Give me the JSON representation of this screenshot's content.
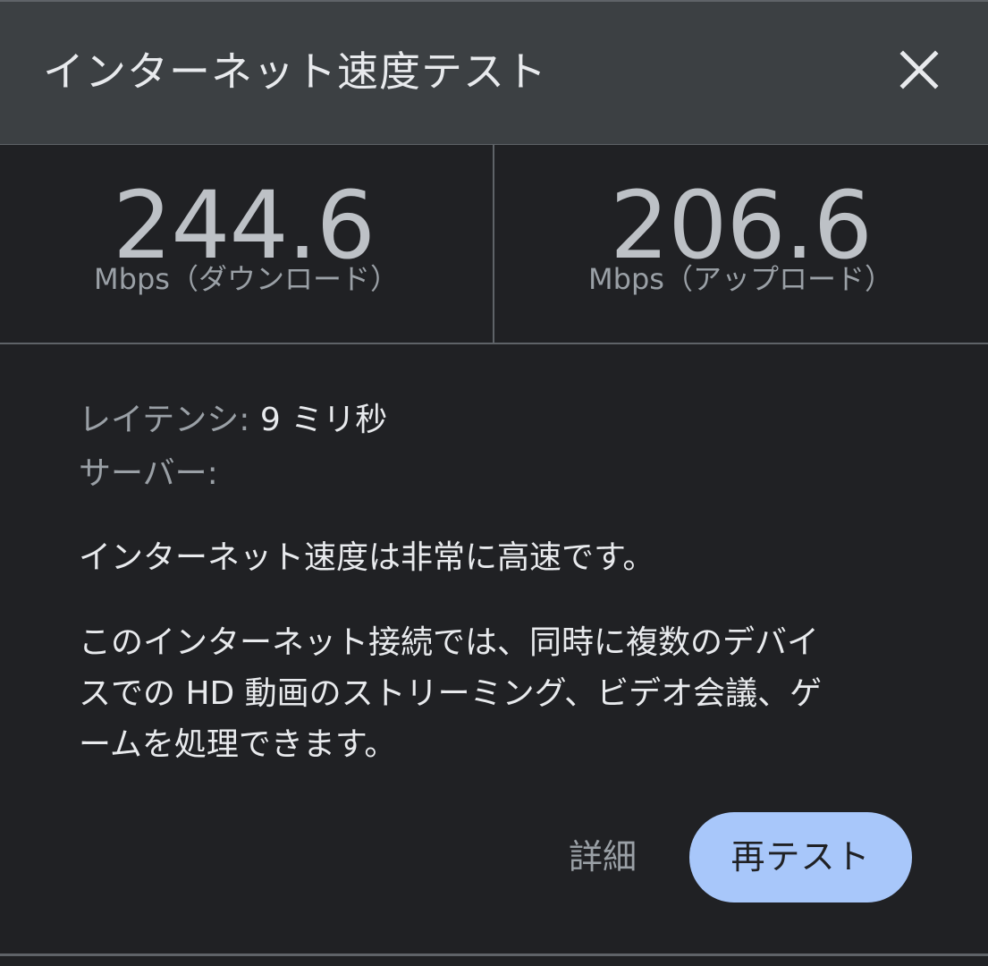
{
  "dialog": {
    "title": "インターネット速度テスト",
    "close_icon": "close-icon"
  },
  "results": {
    "download": {
      "value": "244.6",
      "unit": "Mbps（ダウンロード）"
    },
    "upload": {
      "value": "206.6",
      "unit": "Mbps（アップロード）"
    }
  },
  "info": {
    "latency_label": "レイテンシ: ",
    "latency_value": "9 ミリ秒",
    "server_label": "サーバー:"
  },
  "summary": "インターネット速度は非常に高速です。",
  "description_lines": [
    "このインターネット接続では、同時に複数のデバイ",
    "スでの HD 動画のストリーミング、ビデオ会議、ゲ",
    "ームを処理できます。"
  ],
  "actions": {
    "details_label": "詳細",
    "retest_label": "再テスト"
  },
  "colors": {
    "background": "#202124",
    "header": "#3c4043",
    "accent_button": "#a8c7fa"
  }
}
